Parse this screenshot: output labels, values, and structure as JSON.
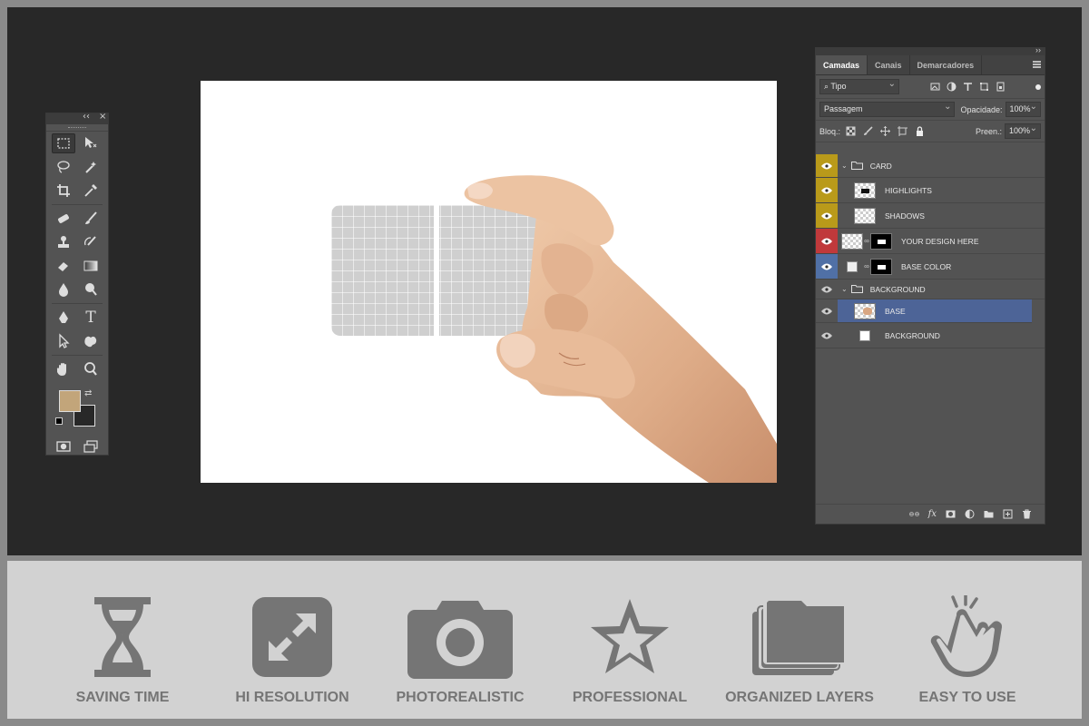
{
  "colors": {
    "workspace": "#282828",
    "panel": "#535353",
    "foreground_swatch": "#c2a57a",
    "background_swatch": "#282828",
    "selected_layer": "#4d6497",
    "eye_yellow": "#b99a1a",
    "eye_red": "#c0393b",
    "eye_blue": "#5070a6",
    "feature_gray": "#757575"
  },
  "toolbar": {
    "collapse_glyph": "‹‹",
    "close_glyph": "×",
    "tools": [
      "marquee-tool",
      "move-tool",
      "lasso-tool",
      "magic-wand-tool",
      "crop-tool",
      "eyedropper-tool",
      "healing-brush-tool",
      "brush-tool",
      "clone-stamp-tool",
      "history-brush-tool",
      "eraser-tool",
      "gradient-tool",
      "blur-tool",
      "dodge-tool",
      "pen-tool",
      "type-tool",
      "path-selection-tool",
      "shape-tool",
      "hand-tool",
      "zoom-tool"
    ],
    "type_tool_glyph": "T"
  },
  "layers_panel": {
    "collapse_glyph": "››",
    "tabs": [
      "Camadas",
      "Canais",
      "Demarcadores"
    ],
    "filter": "Tipo",
    "blend_mode": "Passagem",
    "opacity_label": "Opacidade:",
    "opacity_value": "100%",
    "lock_label": "Bloq.:",
    "fill_label": "Preen.:",
    "fill_value": "100%",
    "layers": [
      {
        "name": "CARD",
        "kind": "group",
        "eye": "yellow"
      },
      {
        "name": "HIGHLIGHTS",
        "kind": "layer",
        "eye": "yellow"
      },
      {
        "name": "SHADOWS",
        "kind": "layer",
        "eye": "yellow"
      },
      {
        "name": "YOUR DESIGN HERE",
        "kind": "smart-masked",
        "eye": "red"
      },
      {
        "name": "BASE COLOR",
        "kind": "fill-masked",
        "eye": "blue"
      },
      {
        "name": "BACKGROUND",
        "kind": "group",
        "eye": "none"
      },
      {
        "name": "BASE",
        "kind": "photo",
        "eye": "none",
        "selected": true
      },
      {
        "name": "BACKGROUND",
        "kind": "fill",
        "eye": "none"
      }
    ]
  },
  "features": [
    {
      "label": "SAVING TIME",
      "icon": "hourglass-icon"
    },
    {
      "label": "HI RESOLUTION",
      "icon": "expand-icon"
    },
    {
      "label": "PHOTOREALISTIC",
      "icon": "camera-icon"
    },
    {
      "label": "PROFESSIONAL",
      "icon": "star-icon"
    },
    {
      "label": "ORGANIZED LAYERS",
      "icon": "layers-icon"
    },
    {
      "label": "EASY TO USE",
      "icon": "tap-hand-icon"
    }
  ]
}
